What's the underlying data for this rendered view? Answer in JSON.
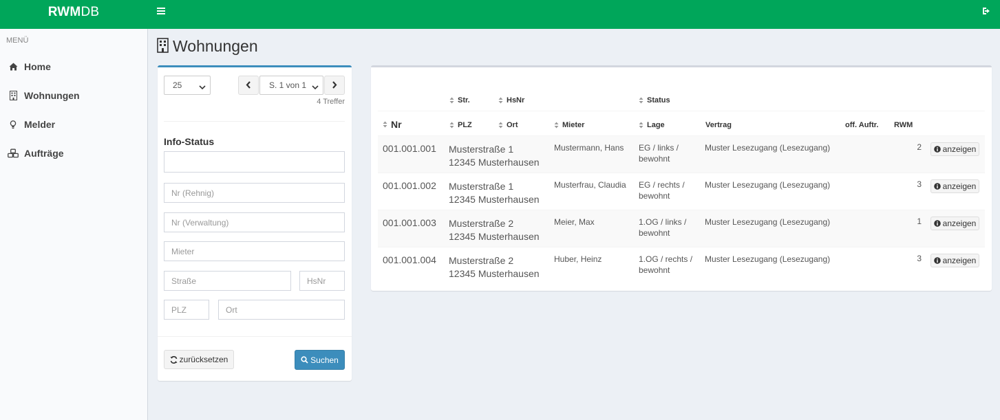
{
  "app": {
    "logo_bold": "RWM",
    "logo_rest": "DB"
  },
  "sidebar": {
    "header": "MENÜ",
    "items": [
      {
        "label": "Home",
        "icon": "home-icon"
      },
      {
        "label": "Wohnungen",
        "icon": "building-icon"
      },
      {
        "label": "Melder",
        "icon": "lightbulb-icon"
      },
      {
        "label": "Aufträge",
        "icon": "cubes-icon"
      }
    ]
  },
  "page": {
    "title": "Wohnungen",
    "title_icon": "building-icon"
  },
  "filter": {
    "page_size": "25",
    "page_select": "S. 1 von 1",
    "hits": "4 Treffer",
    "section_label": "Info-Status",
    "info_status_value": "",
    "placeholders": {
      "nr_rehnig": "Nr (Rehnig)",
      "nr_verwaltung": "Nr (Verwaltung)",
      "mieter": "Mieter",
      "strasse": "Straße",
      "hsnr": "HsNr",
      "plz": "PLZ",
      "ort": "Ort"
    },
    "reset_label": "zurücksetzen",
    "search_label": "Suchen"
  },
  "table": {
    "headers_top": {
      "str": "Str.",
      "hsnr": "HsNr",
      "status": "Status"
    },
    "headers": {
      "nr": "Nr",
      "plz": "PLZ",
      "ort": "Ort",
      "mieter": "Mieter",
      "lage": "Lage",
      "vertrag": "Vertrag",
      "off_auftr": "off. Auftr.",
      "rwm": "RWM"
    },
    "show_label": "anzeigen",
    "rows": [
      {
        "nr": "001.001.001",
        "street": "Musterstraße 1",
        "city": "12345 Musterhausen",
        "mieter": "Mustermann, Hans",
        "lage1": "EG / links /",
        "lage2": "bewohnt",
        "vertrag": "Muster Lesezugang (Lesezugang)",
        "off_auftr": "",
        "rwm": "2"
      },
      {
        "nr": "001.001.002",
        "street": "Musterstraße 1",
        "city": "12345 Musterhausen",
        "mieter": "Musterfrau, Claudia",
        "lage1": "EG / rechts /",
        "lage2": "bewohnt",
        "vertrag": "Muster Lesezugang (Lesezugang)",
        "off_auftr": "",
        "rwm": "3"
      },
      {
        "nr": "001.001.003",
        "street": "Musterstraße 2",
        "city": "12345 Musterhausen",
        "mieter": "Meier, Max",
        "lage1": "1.OG / links /",
        "lage2": "bewohnt",
        "vertrag": "Muster Lesezugang (Lesezugang)",
        "off_auftr": "",
        "rwm": "1"
      },
      {
        "nr": "001.001.004",
        "street": "Musterstraße 2",
        "city": "12345 Musterhausen",
        "mieter": "Huber, Heinz",
        "lage1": "1.OG / rechts /",
        "lage2": "bewohnt",
        "vertrag": "Muster Lesezugang (Lesezugang)",
        "off_auftr": "",
        "rwm": "3"
      }
    ]
  },
  "colors": {
    "topbar": "#00a65a",
    "primary": "#3c8dbc",
    "background": "#ecf0f5"
  }
}
